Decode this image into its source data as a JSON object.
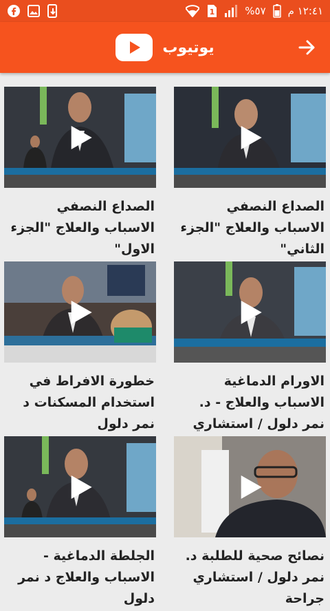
{
  "status_bar": {
    "time": "١٢:٤١ م",
    "battery": "%٥٧",
    "sim_label": "1"
  },
  "header": {
    "title": "يوتيوب",
    "logo_icon": "youtube-logo-icon",
    "back_icon": "arrow-right-icon"
  },
  "videos": [
    {
      "title": "الصداع النصفي الاسباب والعلاج \"الجزء الثاني\"",
      "scene": "a"
    },
    {
      "title": "الصداع النصفي الاسباب والعلاج \"الجزء الاول\"",
      "scene": "b"
    },
    {
      "title": "الاورام الدماغية الاسباب والعلاج - د. نمر دلول / استشاري",
      "scene": "c"
    },
    {
      "title": "خطورة الافراط في استخدام المسكنات د نمر دلول",
      "scene": "d"
    },
    {
      "title": "نصائح صحية للطلبة د. نمر دلول / استشاري جراحة",
      "scene": "e"
    },
    {
      "title": "الجلطة الدماغية - الاسباب والعلاج د نمر دلول",
      "scene": "f"
    }
  ],
  "colors": {
    "status_bar": "#ea4e1e",
    "app_bar": "#f6531e",
    "background": "#ececec"
  }
}
